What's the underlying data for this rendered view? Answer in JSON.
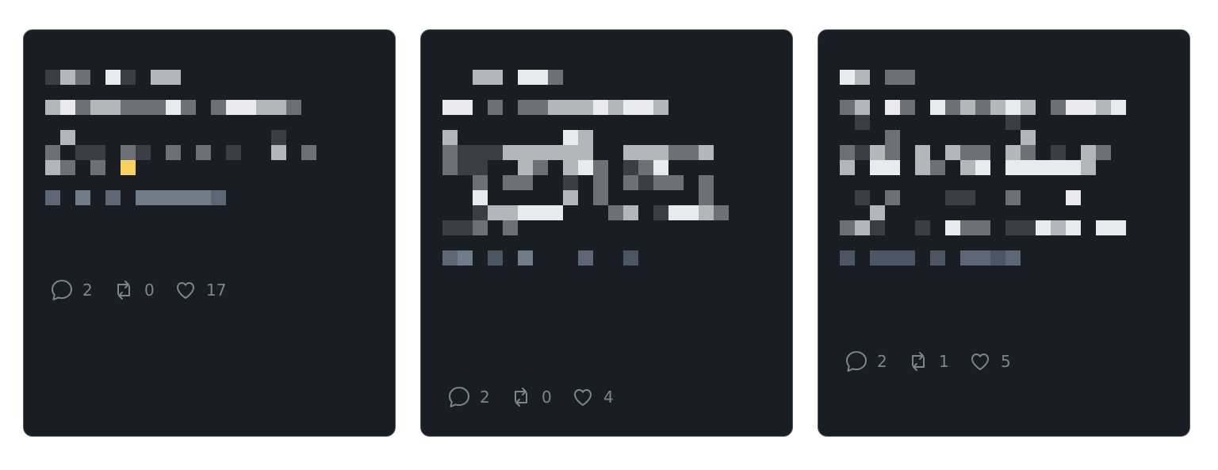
{
  "cards": [
    {
      "stats": {
        "replies": "2",
        "retweets": "0",
        "likes": "17"
      },
      "redacted_rows": [
        [
          1,
          3,
          2,
          0,
          4,
          1,
          0,
          3,
          3,
          0,
          0,
          0,
          0,
          0,
          0,
          0,
          0,
          0,
          0,
          0,
          0,
          0
        ],
        [
          0,
          0,
          0,
          0,
          0,
          0,
          0,
          0,
          0,
          0,
          0,
          0,
          0,
          0,
          0,
          0,
          0,
          0,
          0,
          0,
          0,
          0
        ],
        [
          3,
          4,
          2,
          3,
          3,
          2,
          2,
          2,
          4,
          2,
          0,
          2,
          4,
          4,
          3,
          3,
          2,
          0,
          0,
          0,
          0,
          0
        ],
        [
          0,
          0,
          0,
          0,
          0,
          0,
          0,
          0,
          0,
          0,
          0,
          0,
          0,
          0,
          0,
          0,
          0,
          0,
          0,
          0,
          0,
          0
        ],
        [
          0,
          3,
          0,
          0,
          0,
          0,
          0,
          0,
          0,
          0,
          0,
          0,
          0,
          0,
          0,
          1,
          0,
          0,
          0,
          0,
          0,
          0
        ],
        [
          2,
          0,
          1,
          1,
          0,
          2,
          1,
          0,
          2,
          0,
          2,
          0,
          1,
          0,
          0,
          3,
          0,
          2,
          0,
          0,
          0,
          0
        ],
        [
          3,
          2,
          0,
          2,
          0,
          9,
          0,
          0,
          0,
          0,
          0,
          0,
          0,
          0,
          0,
          0,
          0,
          0,
          0,
          0,
          0,
          0
        ],
        [
          0,
          0,
          0,
          0,
          0,
          0,
          0,
          0,
          0,
          0,
          0,
          0,
          0,
          0,
          0,
          0,
          0,
          0,
          0,
          0,
          0,
          0
        ],
        [
          7,
          0,
          8,
          0,
          7,
          0,
          8,
          8,
          8,
          8,
          8,
          7,
          0,
          0,
          0,
          0,
          0,
          0,
          0,
          0,
          0,
          0
        ]
      ]
    },
    {
      "stats": {
        "replies": "2",
        "retweets": "0",
        "likes": "4"
      },
      "redacted_rows": [
        [
          0,
          0,
          3,
          3,
          0,
          4,
          4,
          2,
          0,
          0,
          0,
          0,
          0,
          0,
          0,
          0,
          0,
          0,
          0,
          0,
          0,
          0
        ],
        [
          0,
          0,
          0,
          0,
          0,
          0,
          0,
          0,
          0,
          0,
          0,
          0,
          0,
          0,
          0,
          0,
          0,
          0,
          0,
          0,
          0,
          0
        ],
        [
          4,
          4,
          0,
          2,
          0,
          2,
          2,
          3,
          3,
          3,
          4,
          3,
          4,
          4,
          3,
          0,
          0,
          0,
          0,
          0,
          0,
          0
        ],
        [
          0,
          0,
          0,
          0,
          0,
          0,
          0,
          0,
          0,
          0,
          0,
          0,
          0,
          0,
          0,
          0,
          0,
          0,
          0,
          0,
          0,
          0
        ],
        [
          3,
          0,
          0,
          0,
          0,
          0,
          0,
          0,
          4,
          3,
          0,
          0,
          0,
          0,
          0,
          0,
          0,
          0,
          0,
          0,
          0,
          0
        ],
        [
          2,
          1,
          1,
          1,
          3,
          3,
          3,
          3,
          3,
          3,
          0,
          0,
          3,
          3,
          3,
          2,
          2,
          3,
          0,
          0,
          0,
          0
        ],
        [
          2,
          1,
          1,
          0,
          0,
          3,
          2,
          0,
          3,
          4,
          2,
          0,
          1,
          2,
          4,
          0,
          0,
          0,
          0,
          0,
          0,
          0
        ],
        [
          0,
          0,
          2,
          0,
          2,
          2,
          0,
          0,
          1,
          0,
          2,
          0,
          2,
          1,
          2,
          2,
          0,
          2,
          0,
          0,
          0,
          0
        ],
        [
          0,
          0,
          4,
          0,
          0,
          0,
          0,
          0,
          3,
          0,
          2,
          0,
          0,
          0,
          0,
          0,
          0,
          2,
          0,
          0,
          0,
          0
        ],
        [
          0,
          0,
          1,
          3,
          3,
          4,
          4,
          4,
          0,
          0,
          0,
          2,
          3,
          0,
          1,
          4,
          4,
          3,
          2,
          0,
          0,
          0
        ],
        [
          1,
          1,
          2,
          0,
          2,
          0,
          0,
          0,
          0,
          0,
          0,
          0,
          0,
          0,
          0,
          0,
          0,
          0,
          0,
          0,
          0,
          0
        ],
        [
          0,
          0,
          0,
          0,
          0,
          0,
          0,
          0,
          0,
          0,
          0,
          0,
          0,
          0,
          0,
          0,
          0,
          0,
          0,
          0,
          0,
          0
        ],
        [
          7,
          8,
          0,
          6,
          0,
          8,
          0,
          0,
          0,
          7,
          0,
          0,
          6,
          0,
          0,
          0,
          0,
          0,
          0,
          0,
          0,
          0
        ]
      ]
    },
    {
      "stats": {
        "replies": "2",
        "retweets": "1",
        "likes": "5"
      },
      "redacted_rows": [
        [
          4,
          3,
          0,
          2,
          2,
          0,
          0,
          0,
          0,
          0,
          0,
          0,
          0,
          0,
          0,
          0,
          0,
          0,
          0,
          0,
          0,
          0
        ],
        [
          0,
          0,
          0,
          0,
          0,
          0,
          0,
          0,
          0,
          0,
          0,
          0,
          0,
          0,
          0,
          0,
          0,
          0,
          0,
          0,
          0,
          0
        ],
        [
          2,
          3,
          0,
          4,
          2,
          0,
          4,
          2,
          3,
          2,
          3,
          4,
          3,
          0,
          2,
          4,
          4,
          3,
          4,
          0,
          0,
          0
        ],
        [
          0,
          1,
          0,
          0,
          0,
          0,
          0,
          0,
          0,
          0,
          0,
          1,
          0,
          0,
          0,
          0,
          0,
          0,
          0,
          0,
          0,
          0
        ],
        [
          0,
          0,
          0,
          2,
          0,
          0,
          0,
          0,
          0,
          0,
          0,
          0,
          3,
          0,
          0,
          0,
          0,
          0,
          0,
          0,
          0,
          0
        ],
        [
          2,
          1,
          3,
          2,
          0,
          3,
          0,
          3,
          2,
          2,
          0,
          3,
          2,
          0,
          1,
          0,
          3,
          2,
          0,
          0,
          0,
          0
        ],
        [
          3,
          0,
          4,
          4,
          0,
          3,
          2,
          0,
          3,
          4,
          0,
          4,
          4,
          4,
          4,
          4,
          3,
          0,
          0,
          0,
          0,
          0
        ],
        [
          0,
          0,
          0,
          0,
          0,
          0,
          0,
          0,
          0,
          0,
          0,
          0,
          0,
          0,
          0,
          0,
          0,
          0,
          0,
          0,
          0,
          0
        ],
        [
          0,
          1,
          0,
          2,
          0,
          0,
          0,
          1,
          1,
          0,
          0,
          2,
          0,
          0,
          0,
          4,
          0,
          0,
          0,
          0,
          0,
          0
        ],
        [
          0,
          0,
          3,
          0,
          0,
          0,
          0,
          0,
          0,
          0,
          0,
          0,
          0,
          0,
          0,
          0,
          0,
          0,
          0,
          0,
          0,
          0
        ],
        [
          2,
          3,
          1,
          0,
          0,
          1,
          0,
          4,
          2,
          2,
          0,
          1,
          1,
          4,
          3,
          4,
          0,
          4,
          4,
          0,
          0,
          0
        ],
        [
          0,
          0,
          0,
          0,
          0,
          0,
          0,
          0,
          0,
          0,
          0,
          0,
          0,
          0,
          0,
          0,
          0,
          0,
          0,
          0,
          0,
          0
        ],
        [
          6,
          0,
          6,
          6,
          6,
          0,
          6,
          0,
          7,
          7,
          6,
          7,
          0,
          0,
          0,
          0,
          0,
          0,
          0,
          0,
          0,
          0
        ]
      ]
    }
  ],
  "palette": {
    "0": "#191e25",
    "1": "#3a3f45",
    "2": "#6d7177",
    "3": "#b3b6ba",
    "4": "#e8eaee",
    "6": "#4b5563",
    "7": "#5d6775",
    "8": "#717c8a",
    "9": "#f7d25c"
  },
  "colors": {
    "page_background": "#ffffff",
    "card_background": "#191e25",
    "card_border": "#4d5661",
    "stat_text": "#7d858f"
  },
  "icons": {
    "reply": "speech-bubble-icon",
    "retweet": "retweet-arrows-icon",
    "like": "heart-icon"
  }
}
